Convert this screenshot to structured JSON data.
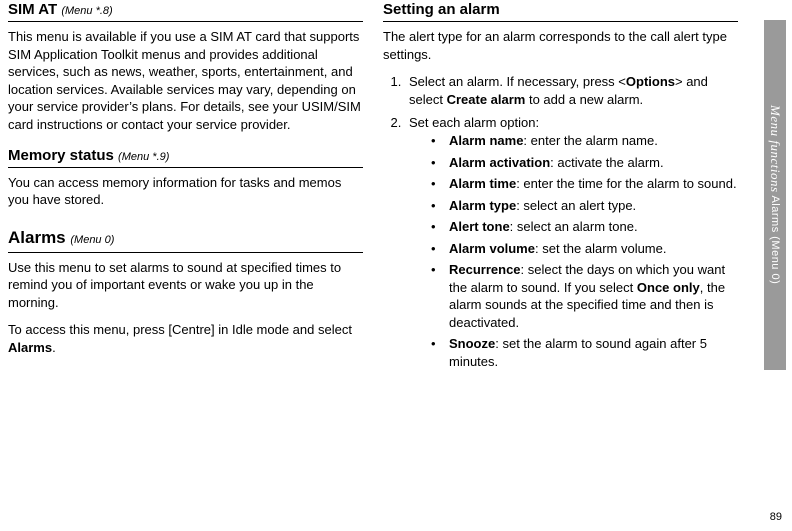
{
  "left": {
    "sec1": {
      "title": "SIM AT",
      "menu": "(Menu *.8)",
      "body": "This menu is available if you use a SIM AT card that supports SIM Application Toolkit menus and provides additional services, such as news, weather, sports, entertainment, and location services. Available services may vary, depending on your service provider’s plans. For details, see your USIM/SIM card instructions or contact your service provider."
    },
    "sec2": {
      "title": "Memory status",
      "menu": "(Menu *.9)",
      "body": "You can access memory information for tasks and memos you have stored."
    },
    "sec3": {
      "title": "Alarms",
      "menu": "(Menu 0)",
      "p1": "Use this menu to set alarms to sound at specified times to remind you of important events or wake you up in the morning.",
      "p2_pre": "To access this menu, press [Centre] in Idle mode and select ",
      "p2_bold": "Alarms",
      "p2_post": "."
    }
  },
  "right": {
    "sec1": {
      "title": "Setting an alarm",
      "intro": "The alert type for an alarm corresponds to the call alert type settings.",
      "step1_pre": "Select an alarm. If necessary, press <",
      "step1_b1": "Options",
      "step1_mid": "> and select ",
      "step1_b2": "Create alarm",
      "step1_post": " to add a new alarm.",
      "step2": "Set each alarm option:",
      "opts": [
        {
          "name": "Alarm name",
          "desc": ": enter the alarm name."
        },
        {
          "name": "Alarm activation",
          "desc": ": activate the alarm."
        },
        {
          "name": "Alarm time",
          "desc": ": enter the time for the alarm to sound."
        },
        {
          "name": "Alarm type",
          "desc": ": select an alert type."
        },
        {
          "name": "Alert tone",
          "desc": ": select an alarm tone."
        },
        {
          "name": "Alarm volume",
          "desc": ": set the alarm volume."
        },
        {
          "name": "Recurrence",
          "desc_pre": ": select the days on which you want the alarm to sound. If you select ",
          "desc_bold": "Once only",
          "desc_post": ", the alarm sounds at the specified time and then is deactivated."
        },
        {
          "name": "Snooze",
          "desc": ": set the alarm to sound again after 5 minutes."
        }
      ]
    }
  },
  "side": {
    "italic": "Menu functions",
    "plain": "    Alarms (Menu 0)"
  },
  "pageNumber": "89"
}
